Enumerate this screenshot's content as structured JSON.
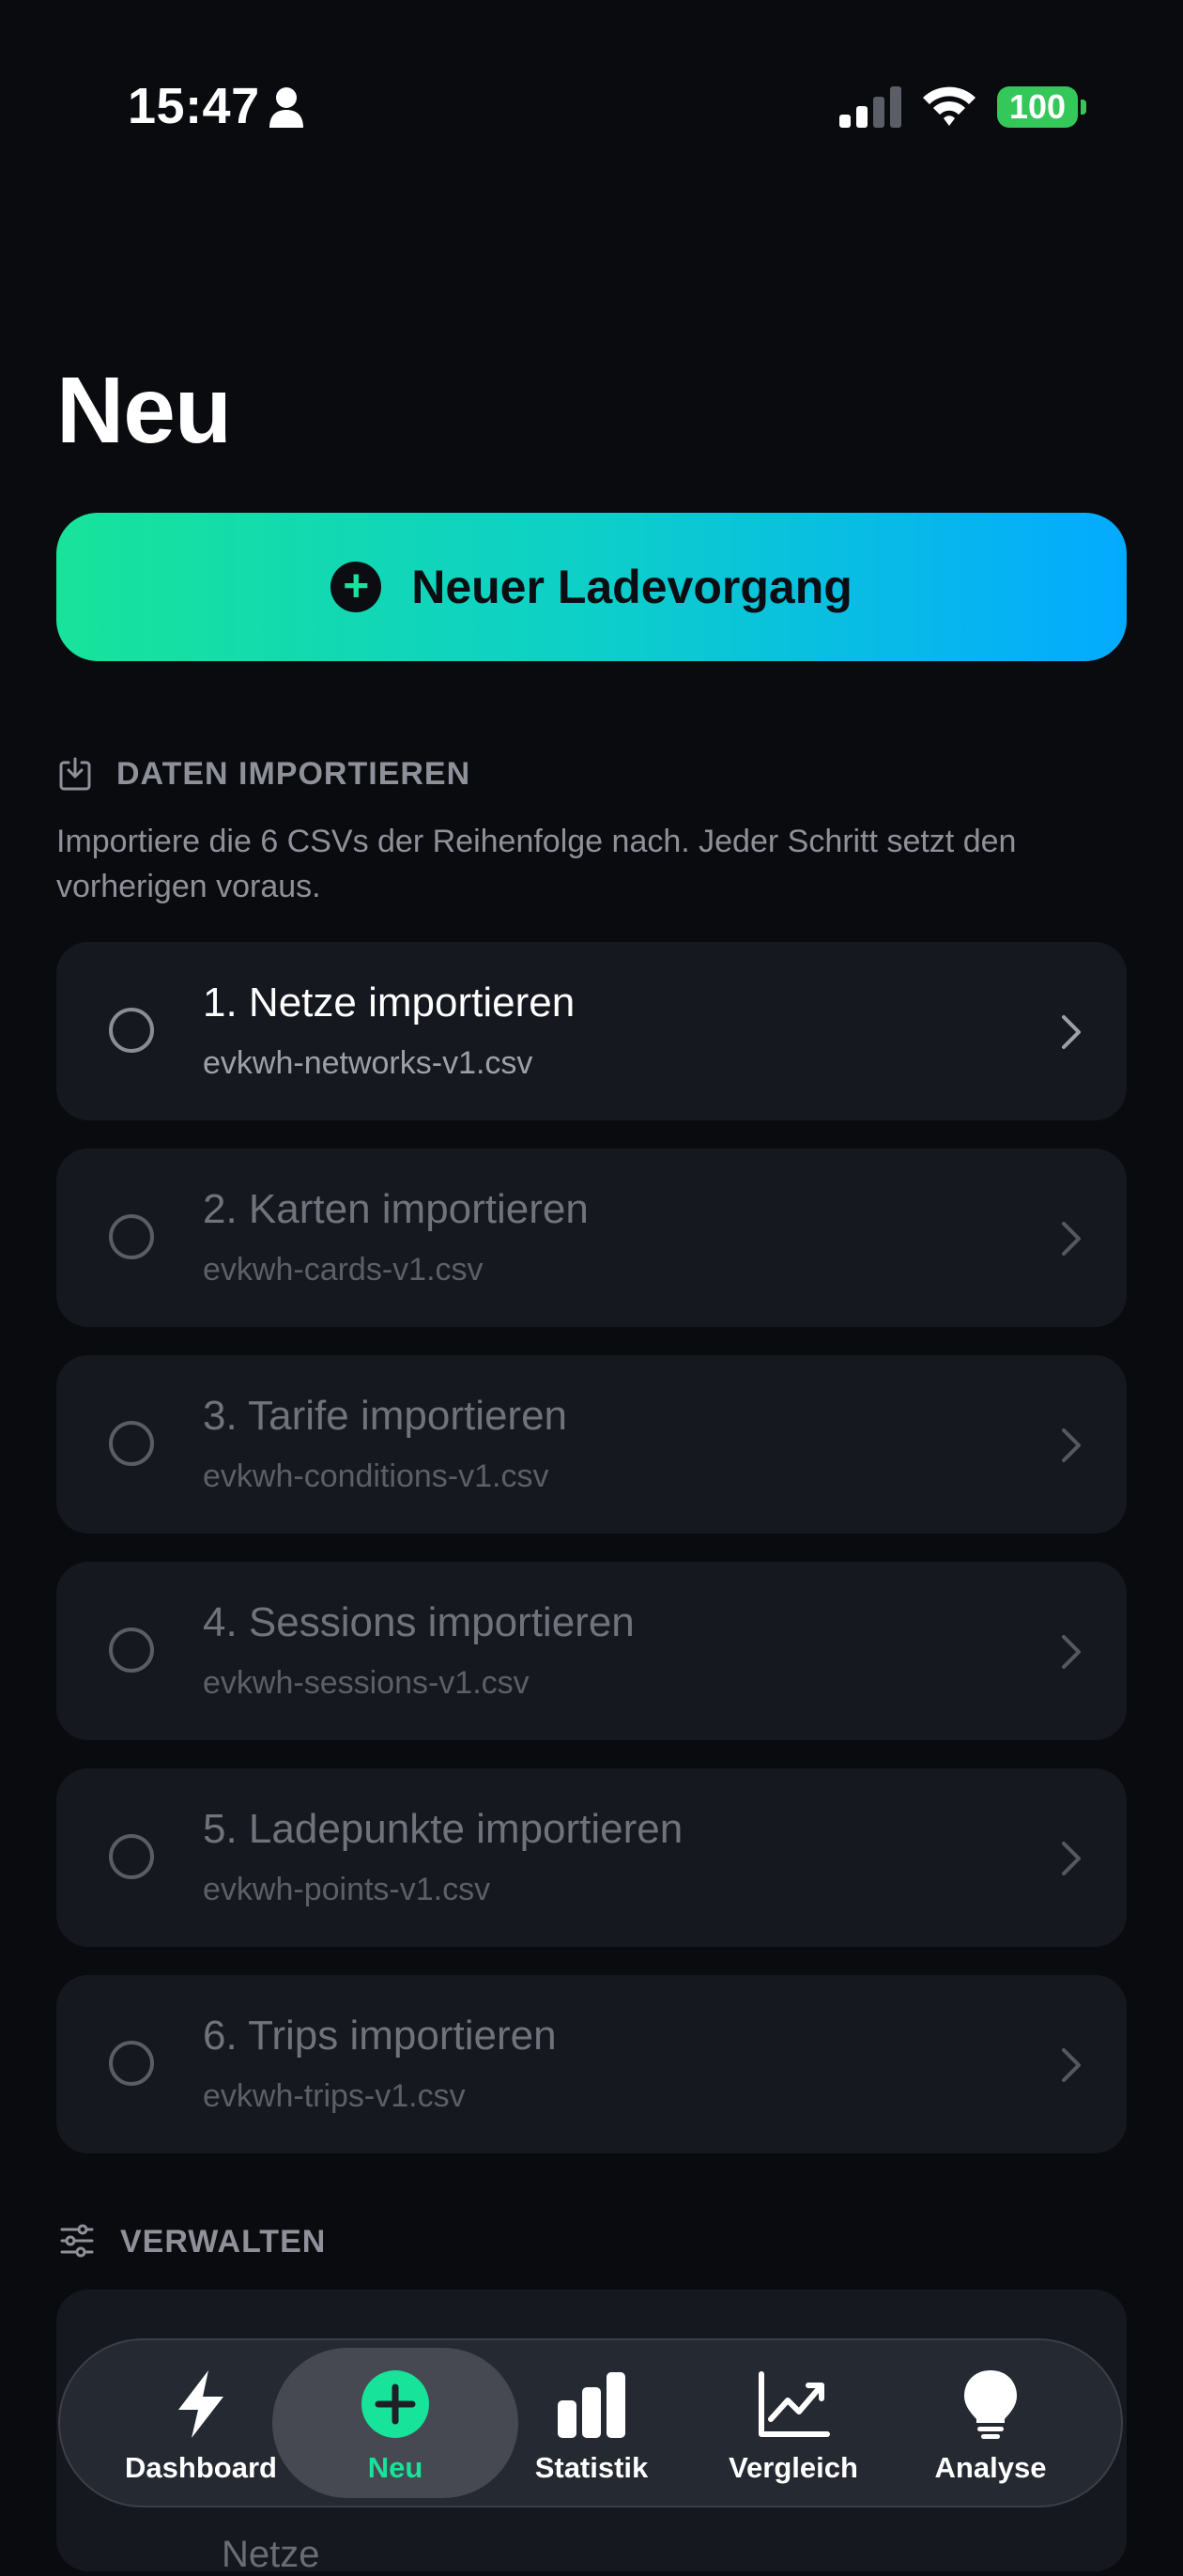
{
  "status_bar": {
    "time": "15:47",
    "battery": "100"
  },
  "page": {
    "title": "Neu"
  },
  "new_button": {
    "label": "Neuer Ladevorgang"
  },
  "import_section": {
    "header": "DATEN IMPORTIEREN",
    "description": "Importiere die 6 CSVs der Reihenfolge nach. Jeder Schritt setzt den vorherigen voraus.",
    "steps": [
      {
        "title": "1. Netze importieren",
        "file": "evkwh-networks-v1.csv"
      },
      {
        "title": "2. Karten importieren",
        "file": "evkwh-cards-v1.csv"
      },
      {
        "title": "3. Tarife importieren",
        "file": "evkwh-conditions-v1.csv"
      },
      {
        "title": "4. Sessions importieren",
        "file": "evkwh-sessions-v1.csv"
      },
      {
        "title": "5. Ladepunkte importieren",
        "file": "evkwh-points-v1.csv"
      },
      {
        "title": "6. Trips importieren",
        "file": "evkwh-trips-v1.csv"
      }
    ]
  },
  "manage_section": {
    "header": "VERWALTEN",
    "first_item": "Netze"
  },
  "tabs": [
    {
      "label": "Dashboard",
      "icon": "bolt-icon"
    },
    {
      "label": "Neu",
      "icon": "plus-circle-icon"
    },
    {
      "label": "Statistik",
      "icon": "bar-chart-icon"
    },
    {
      "label": "Vergleich",
      "icon": "trend-chart-icon"
    },
    {
      "label": "Analyse",
      "icon": "lightbulb-icon"
    }
  ],
  "colors": {
    "accent": "#18e39a",
    "gradient_end": "#04aaff",
    "background": "#0a0b0f",
    "card": "#16181f"
  }
}
